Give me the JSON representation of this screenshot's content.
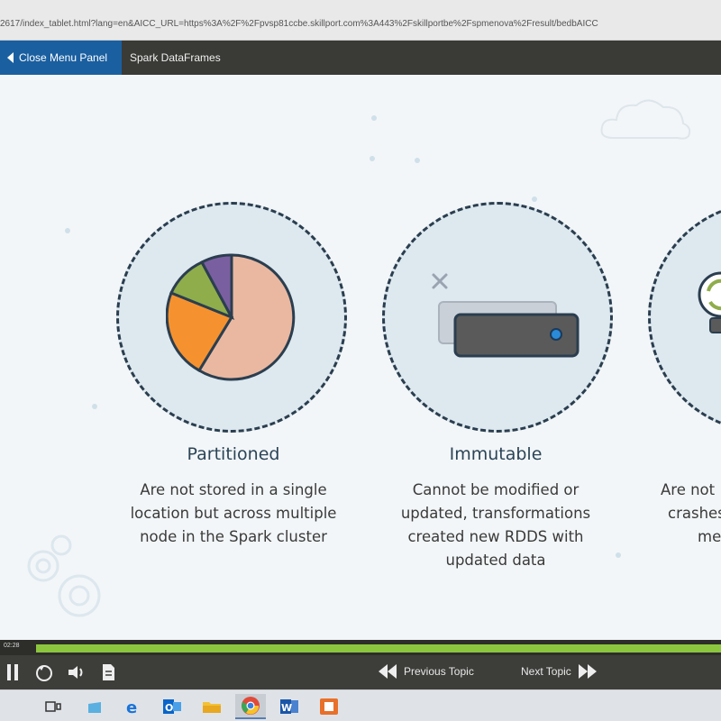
{
  "browser": {
    "url": "2617/index_tablet.html?lang=en&AICC_URL=https%3A%2F%2Fpvsp81ccbe.skillport.com%3A443%2Fskillportbe%2Fspmenova%2Fresult/bedbAICC"
  },
  "course_header": {
    "close_menu_label": "Close Menu Panel",
    "title": "Spark DataFrames"
  },
  "slide": {
    "items": [
      {
        "heading": "Partitioned",
        "description_lines": [
          "Are not stored in a single",
          "location but across multiple",
          "node in the Spark cluster"
        ],
        "icon": "pie-chart-icon"
      },
      {
        "heading": "Immutable",
        "description_lines": [
          "Cannot be modified or",
          "updated, transformations",
          "created new RDDS with",
          "updated data"
        ],
        "icon": "storage-drive-icon"
      },
      {
        "description_lines": [
          "Are not",
          "crashes,",
          "met"
        ],
        "icon": "refresh-icon"
      }
    ],
    "pie_colors": [
      "#eab8a0",
      "#f5922f",
      "#8fad4a",
      "#7a5fa0"
    ],
    "accent_color": "#1a5fa0",
    "progress_color": "#8cc63f"
  },
  "player": {
    "elapsed_time": "02:28",
    "progress_fraction": 0.0,
    "previous_label": "Previous Topic",
    "next_label": "Next Topic"
  },
  "taskbar": {
    "apps": [
      "task-view-icon",
      "store-icon",
      "edge-icon",
      "outlook-icon",
      "file-explorer-icon",
      "chrome-icon",
      "word-icon",
      "app-icon"
    ]
  }
}
